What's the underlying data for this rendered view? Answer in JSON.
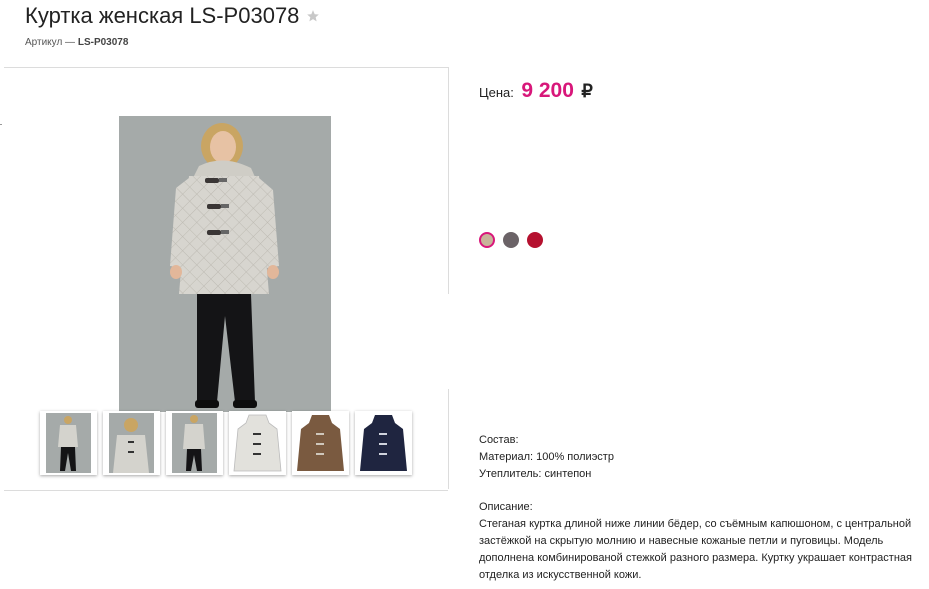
{
  "product": {
    "title": "Куртка женская LS-P03078",
    "sku_label": "Артикул —",
    "sku_value": "LS-P03078"
  },
  "price": {
    "label": "Цена:",
    "value": "9 200",
    "currency": "₽"
  },
  "colors": [
    {
      "name": "beige",
      "hex": "#c8b49a",
      "selected": true
    },
    {
      "name": "gray",
      "hex": "#6b6367",
      "selected": false
    },
    {
      "name": "red",
      "hex": "#b5112f",
      "selected": false
    }
  ],
  "thumbnails": [
    {
      "kind": "photo-full",
      "coat": "#d4d3cd"
    },
    {
      "kind": "photo-upper",
      "coat": "#d4d3cd"
    },
    {
      "kind": "photo-back",
      "coat": "#d4d3cd"
    },
    {
      "kind": "coat-only",
      "coat": "#e2e1dc"
    },
    {
      "kind": "coat-only",
      "coat": "#7a5a40"
    },
    {
      "kind": "coat-only",
      "coat": "#1f2540"
    }
  ],
  "composition": {
    "heading": "Состав:",
    "material": "Материал: 100% полиэстр",
    "insulation": "Утеплитель: синтепон"
  },
  "description": {
    "heading": "Описание:",
    "text": "Стеганая куртка длиной ниже линии бёдер, со съёмным капюшоном, с центральной застёжкой на скрытую молнию и навесные кожаные петли и пуговицы. Модель дополнена комбинированой стежкой разного размера. Куртку украшает контрастная отделка из искусственной кожи."
  },
  "icons": {
    "favorite": "star-icon"
  }
}
